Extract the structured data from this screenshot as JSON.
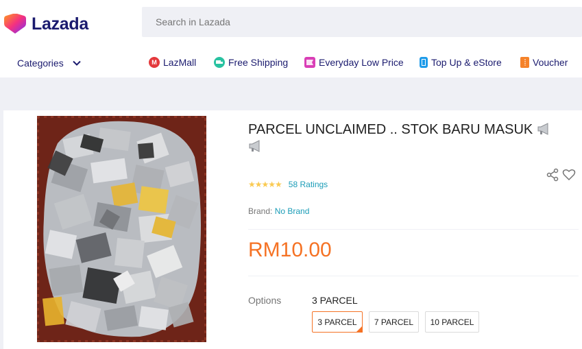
{
  "app": {
    "logo_text": "Lazada"
  },
  "search": {
    "placeholder": "Search in Lazada"
  },
  "categories": {
    "label": "Categories"
  },
  "nav": [
    {
      "label": "LazMall",
      "icon": "lazmall-icon",
      "color": "#e4393c"
    },
    {
      "label": "Free Shipping",
      "icon": "truck-icon",
      "color": "#29c2a1"
    },
    {
      "label": "Everyday Low Price",
      "icon": "price-tag-icon",
      "color": "#d93eb6"
    },
    {
      "label": "Top Up & eStore",
      "icon": "phone-icon",
      "color": "#1e9be9"
    },
    {
      "label": "Voucher",
      "icon": "voucher-icon",
      "color": "#f58229"
    }
  ],
  "product": {
    "title": "PARCEL UNCLAIMED .. STOK BARU MASUK",
    "rating_count": "58 Ratings",
    "stars": "★★★★★",
    "brand_label": "Brand:",
    "brand_value": "No Brand",
    "price": "RM10.00",
    "options_label": "Options",
    "options_selected": "3 PARCEL",
    "options": [
      "3 PARCEL",
      "7 PARCEL",
      "10 PARCEL"
    ]
  },
  "colors": {
    "brand_navy": "#1a1a6e",
    "accent_orange": "#f57224",
    "link_teal": "#1a9cb7",
    "star_yellow": "#faca51"
  }
}
